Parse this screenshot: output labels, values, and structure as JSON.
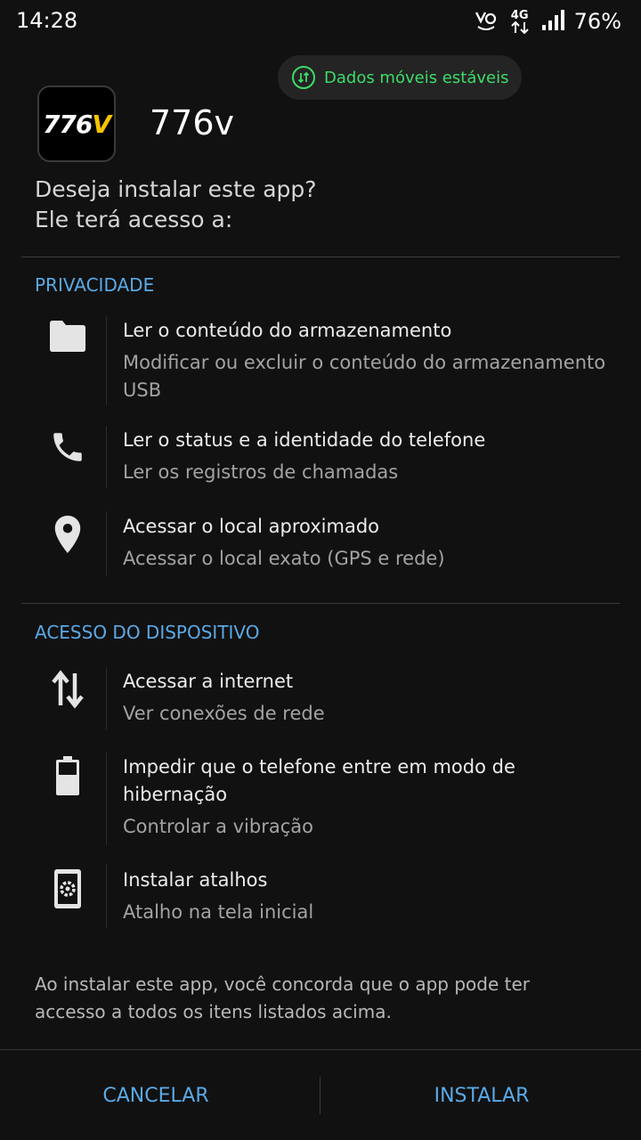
{
  "status_bar": {
    "time": "14:28",
    "network_type": "4G",
    "battery": "76%"
  },
  "toast": {
    "text": "Dados móveis estáveis",
    "icon": "data-stable-icon",
    "color": "#3ddc68"
  },
  "app": {
    "name": "776v",
    "logo_number": "776",
    "logo_letter": "V",
    "logo_accent": "#f5c400"
  },
  "prompt": {
    "line1": "Deseja instalar este app?",
    "line2": "Ele terá acesso a:"
  },
  "sections": [
    {
      "title": "PRIVACIDADE",
      "items": [
        {
          "icon": "folder-icon",
          "title": "Ler o conteúdo do armazenamento",
          "subtitle": "Modificar ou excluir o conteúdo do armazenamento USB"
        },
        {
          "icon": "phone-icon",
          "title": "Ler o status e a identidade do telefone",
          "subtitle": "Ler os registros de chamadas"
        },
        {
          "icon": "location-pin-icon",
          "title": "Acessar o local aproximado",
          "subtitle": "Acessar o local exato (GPS e rede)"
        }
      ]
    },
    {
      "title": "ACESSO DO DISPOSITIVO",
      "items": [
        {
          "icon": "swap-vertical-icon",
          "title": "Acessar a internet",
          "subtitle": "Ver conexões de rede"
        },
        {
          "icon": "battery-icon",
          "title": "Impedir que o telefone entre em modo de hibernação",
          "subtitle": "Controlar a vibração"
        },
        {
          "icon": "settings-cell-icon",
          "title": "Instalar atalhos",
          "subtitle": "Atalho na tela inicial"
        }
      ]
    }
  ],
  "footer_note": "Ao instalar este app, você concorda que o app pode ter accesso a todos os itens listados acima.",
  "buttons": {
    "cancel": "CANCELAR",
    "install": "INSTALAR"
  },
  "accent_color": "#5aa9e6"
}
